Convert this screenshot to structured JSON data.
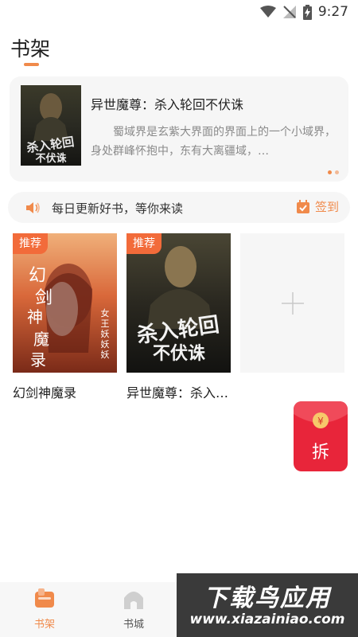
{
  "status_bar": {
    "time": "9:27"
  },
  "header": {
    "title": "书架"
  },
  "banner": {
    "book_title": "异世魔尊：杀入轮回不伏诛",
    "description": "蜀域界是玄紫大界面的界面上的一个小域界，身处群峰怀抱中，东有大离疆域，…",
    "cover_text": "杀入轮回不伏诛"
  },
  "notice": {
    "text": "每日更新好书，等你来读",
    "signin_label": "签到"
  },
  "books": [
    {
      "name": "幻剑神魔录",
      "tag": "推荐",
      "cover_title": "幻剑神魔录",
      "cover_author": "女王妖妖妖·著"
    },
    {
      "name": "异世魔尊：杀入…",
      "tag": "推荐",
      "cover_title": "杀入轮回不伏诛"
    }
  ],
  "red_packet": {
    "label": "拆",
    "symbol": "¥"
  },
  "bottom_nav": [
    {
      "label": "书架",
      "active": true
    },
    {
      "label": "书城",
      "active": false
    }
  ],
  "watermark": {
    "title": "下载鸟应用",
    "url": "www.xiazainiao.com"
  },
  "colors": {
    "accent": "#f08a4b",
    "tag": "#f26b3a",
    "red_packet": "#e8253a"
  }
}
